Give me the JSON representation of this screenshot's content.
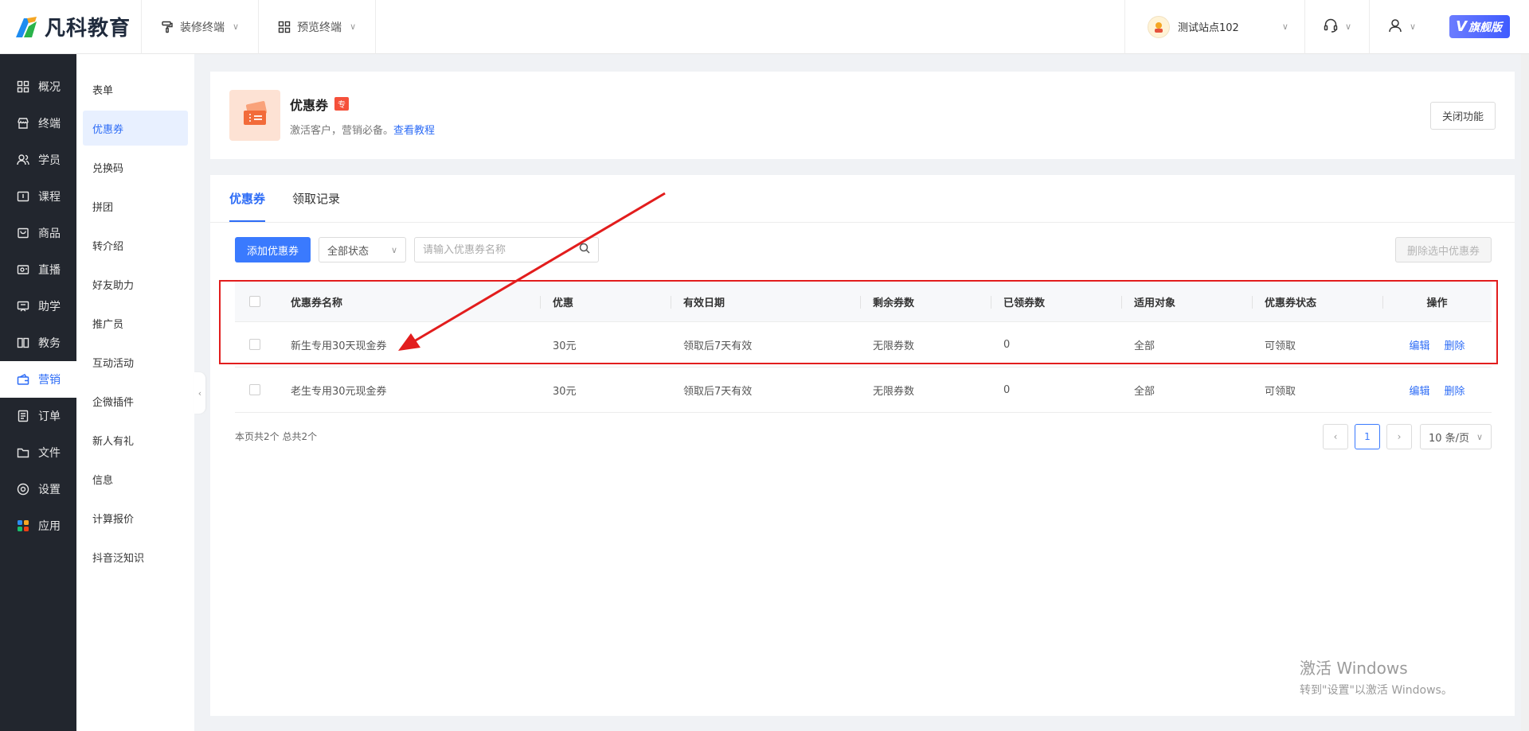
{
  "brand": {
    "name": "凡科教育"
  },
  "top_menus": [
    {
      "label": "装修终端",
      "icon": "paint-roller-icon"
    },
    {
      "label": "预览终端",
      "icon": "grid-icon"
    }
  ],
  "site": {
    "name": "测试站点102"
  },
  "vip_badge": {
    "label": "旗舰版",
    "letter": "V"
  },
  "sidebar": {
    "items": [
      {
        "label": "概况",
        "icon": "dashboard-icon"
      },
      {
        "label": "终端",
        "icon": "store-icon"
      },
      {
        "label": "学员",
        "icon": "users-icon"
      },
      {
        "label": "课程",
        "icon": "course-icon"
      },
      {
        "label": "商品",
        "icon": "bag-icon"
      },
      {
        "label": "直播",
        "icon": "live-icon"
      },
      {
        "label": "助学",
        "icon": "help-study-icon"
      },
      {
        "label": "教务",
        "icon": "book-icon"
      },
      {
        "label": "营销",
        "icon": "marketing-icon",
        "active": true
      },
      {
        "label": "订单",
        "icon": "order-icon"
      },
      {
        "label": "文件",
        "icon": "folder-icon"
      },
      {
        "label": "设置",
        "icon": "settings-icon"
      },
      {
        "label": "应用",
        "icon": "apps-icon"
      }
    ]
  },
  "submenu": {
    "items": [
      "表单",
      "优惠券",
      "兑换码",
      "拼团",
      "转介绍",
      "好友助力",
      "推广员",
      "互动活动",
      "企微插件",
      "新人有礼",
      "信息",
      "计算报价",
      "抖音泛知识"
    ],
    "active_index": 1
  },
  "feature": {
    "title": "优惠券",
    "tag": "专",
    "desc": "激活客户，营销必备。",
    "link": "查看教程",
    "close_label": "关闭功能"
  },
  "tabs": [
    {
      "label": "优惠券",
      "active": true
    },
    {
      "label": "领取记录",
      "active": false
    }
  ],
  "toolbar": {
    "add_label": "添加优惠券",
    "status_select": "全部状态",
    "search_placeholder": "请输入优惠券名称",
    "delete_selected_label": "删除选中优惠券"
  },
  "table": {
    "headers": [
      "优惠券名称",
      "优惠",
      "有效日期",
      "剩余券数",
      "已领券数",
      "适用对象",
      "优惠券状态",
      "操作"
    ],
    "rows": [
      {
        "name": "新生专用30天现金券",
        "discount": "30元",
        "validity": "领取后7天有效",
        "remaining": "无限券数",
        "taken": "0",
        "target": "全部",
        "status": "可领取",
        "edit": "编辑",
        "delete": "删除"
      },
      {
        "name": "老生专用30元现金券",
        "discount": "30元",
        "validity": "领取后7天有效",
        "remaining": "无限券数",
        "taken": "0",
        "target": "全部",
        "status": "可领取",
        "edit": "编辑",
        "delete": "删除"
      }
    ]
  },
  "pagination": {
    "summary": "本页共2个 总共2个",
    "current_page": "1",
    "page_size": "10 条/页"
  },
  "watermark": {
    "line1": "激活 Windows",
    "line2": "转到\"设置\"以激活 Windows。"
  },
  "colors": {
    "accent": "#2d6cf6",
    "annotation": "#e21d1d",
    "sidebar_bg": "#22262e"
  }
}
